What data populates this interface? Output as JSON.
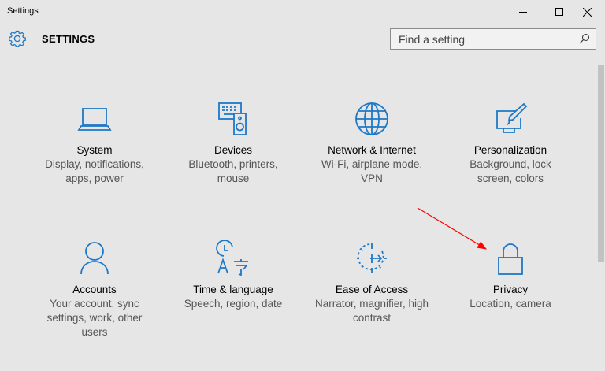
{
  "window": {
    "title": "Settings"
  },
  "header": {
    "title": "SETTINGS",
    "search_placeholder": "Find a setting"
  },
  "colors": {
    "accent": "#1e78c8",
    "annotation": "#ff0000"
  },
  "tiles": [
    {
      "name": "System",
      "desc": "Display, notifications, apps, power",
      "icon": "laptop-icon"
    },
    {
      "name": "Devices",
      "desc": "Bluetooth, printers, mouse",
      "icon": "devices-icon"
    },
    {
      "name": "Network & Internet",
      "desc": "Wi-Fi, airplane mode, VPN",
      "icon": "globe-icon"
    },
    {
      "name": "Personalization",
      "desc": "Background, lock screen, colors",
      "icon": "paint-icon"
    },
    {
      "name": "Accounts",
      "desc": "Your account, sync settings, work, other users",
      "icon": "person-icon"
    },
    {
      "name": "Time & language",
      "desc": "Speech, region, date",
      "icon": "time-language-icon"
    },
    {
      "name": "Ease of Access",
      "desc": "Narrator, magnifier, high contrast",
      "icon": "ease-of-access-icon"
    },
    {
      "name": "Privacy",
      "desc": "Location, camera",
      "icon": "lock-icon"
    }
  ]
}
